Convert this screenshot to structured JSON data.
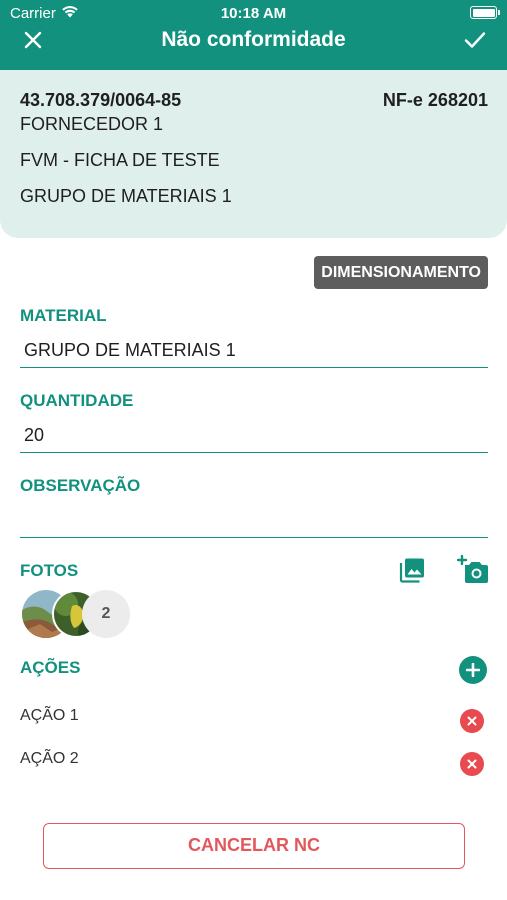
{
  "status_bar": {
    "carrier": "Carrier",
    "time": "10:18 AM"
  },
  "nav": {
    "title": "Não conformidade"
  },
  "info": {
    "cnpj": "43.708.379/0064-85",
    "nfe": "NF-e 268201",
    "fornecedor": "FORNECEDOR 1",
    "ficha": "FVM - FICHA DE TESTE",
    "grupo": "GRUPO DE MATERIAIS 1"
  },
  "dimensionamento_label": "DIMENSIONAMENTO",
  "material": {
    "label": "MATERIAL",
    "value": "GRUPO DE MATERIAIS 1"
  },
  "quantidade": {
    "label": "QUANTIDADE",
    "value": "20"
  },
  "observacao": {
    "label": "OBSERVAÇÃO",
    "value": ""
  },
  "fotos": {
    "label": "FOTOS",
    "more_count": "2"
  },
  "acoes": {
    "label": "AÇÕES",
    "items": [
      "AÇÃO 1",
      "AÇÃO 2"
    ]
  },
  "cancel_label": "CANCELAR NC",
  "colors": {
    "primary": "#12917f",
    "card": "#dff0ec",
    "danger": "#e84a4f",
    "dark_button": "#5d5d5d"
  }
}
